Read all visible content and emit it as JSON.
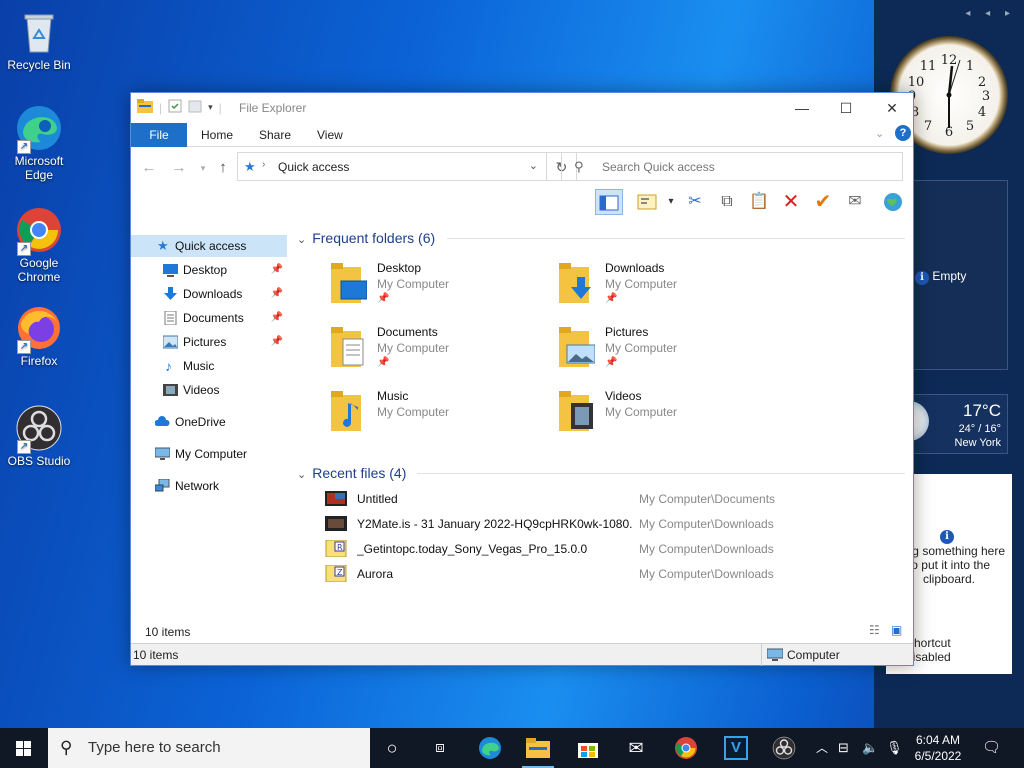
{
  "desktop": {
    "icons": [
      {
        "label": "Recycle Bin"
      },
      {
        "label": "Microsoft Edge"
      },
      {
        "label": "Google Chrome"
      },
      {
        "label": "Firefox"
      },
      {
        "label": "OBS Studio"
      }
    ]
  },
  "sidebar": {
    "arrows": "◂ ◂ ▸",
    "slideshow_text": "Empty",
    "weather": {
      "temp": "17°C",
      "range": "24° / 16°",
      "city": "New York"
    },
    "clipboard": {
      "text": "Drag something here to put it into the clipboard.",
      "shortcut": "Shortcut disabled"
    }
  },
  "explorer": {
    "title": "File Explorer",
    "tabs": {
      "file": "File",
      "home": "Home",
      "share": "Share",
      "view": "View"
    },
    "address": "Quick access",
    "search_placeholder": "Search Quick access",
    "nav": {
      "quick_access": "Quick access",
      "desktop": "Desktop",
      "downloads": "Downloads",
      "documents": "Documents",
      "pictures": "Pictures",
      "music": "Music",
      "videos": "Videos",
      "onedrive": "OneDrive",
      "my_computer": "My Computer",
      "network": "Network"
    },
    "frequent_header": "Frequent folders (6)",
    "folders": [
      {
        "name": "Desktop",
        "path": "My Computer"
      },
      {
        "name": "Downloads",
        "path": "My Computer"
      },
      {
        "name": "Documents",
        "path": "My Computer"
      },
      {
        "name": "Pictures",
        "path": "My Computer"
      },
      {
        "name": "Music",
        "path": "My Computer"
      },
      {
        "name": "Videos",
        "path": "My Computer"
      }
    ],
    "recent_header": "Recent files (4)",
    "recent": [
      {
        "name": "Untitled",
        "location": "My Computer\\Documents"
      },
      {
        "name": "Y2Mate.is - 31 January 2022-HQ9cpHRK0wk-1080...",
        "location": "My Computer\\Downloads"
      },
      {
        "name": "_Getintopc.today_Sony_Vegas_Pro_15.0.0",
        "location": "My Computer\\Downloads"
      },
      {
        "name": "Aurora",
        "location": "My Computer\\Downloads"
      }
    ],
    "item_count": "10 items",
    "status_count": "10 items",
    "status_location": "Computer"
  },
  "taskbar": {
    "search_placeholder": "Type here to search",
    "time": "6:04 AM",
    "date": "6/5/2022"
  },
  "colors": {
    "accent": "#1e6fc8",
    "selection": "#cce4f7",
    "taskbar": "#101826",
    "group_header": "#1e3f8a"
  }
}
